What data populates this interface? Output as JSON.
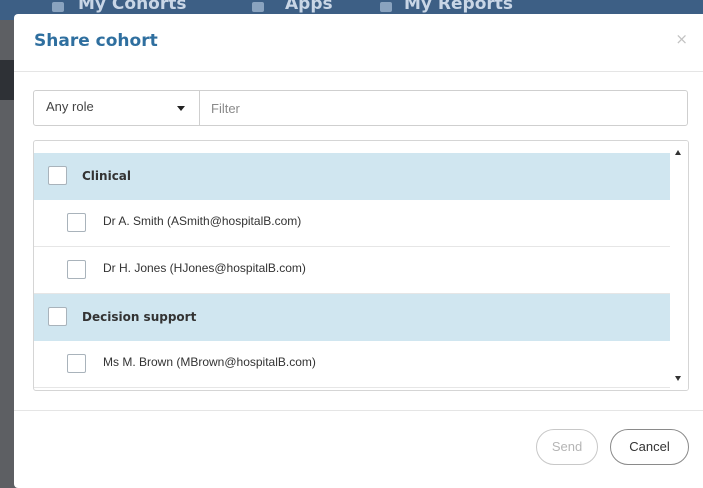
{
  "background": {
    "nav_items": [
      "My Cohorts",
      "Apps",
      "My Reports"
    ]
  },
  "modal": {
    "title": "Share cohort",
    "close_glyph": "×"
  },
  "filter": {
    "role_value": "Any role",
    "placeholder": "Filter",
    "value": ""
  },
  "list": {
    "groups": [
      {
        "label": "Clinical",
        "users": [
          {
            "label": "Dr A. Smith (ASmith@hospitalB.com)"
          },
          {
            "label": "Dr H. Jones (HJones@hospitalB.com)"
          }
        ]
      },
      {
        "label": "Decision support",
        "users": [
          {
            "label": "Ms M. Brown (MBrown@hospitalB.com)"
          }
        ]
      }
    ]
  },
  "footer": {
    "send_label": "Send",
    "cancel_label": "Cancel"
  },
  "colors": {
    "title": "#2f6f9f",
    "group_row_bg": "#d0e6f0",
    "overlay": "#5d5f63"
  }
}
